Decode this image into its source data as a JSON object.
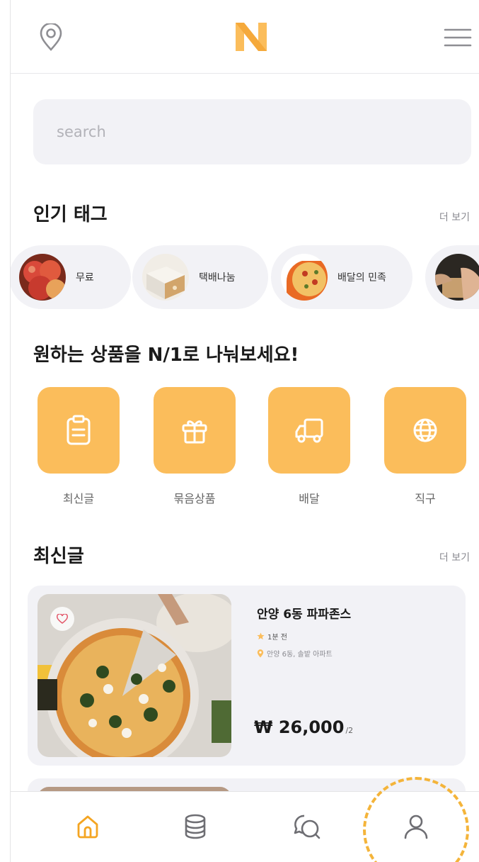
{
  "colors": {
    "accent": "#fbbd5b",
    "nav_active": "#f4a522",
    "surface": "#f2f2f6"
  },
  "header": {
    "logo_text": "N",
    "location_icon": "location-pin-icon",
    "menu_icon": "hamburger-menu-icon"
  },
  "search": {
    "placeholder": "search"
  },
  "popular_tags": {
    "title": "인기 태그",
    "more": "더 보기",
    "items": [
      {
        "label": "무료",
        "image": "apples"
      },
      {
        "label": "택배나눔",
        "image": "parcel-box"
      },
      {
        "label": "배달의 민족",
        "image": "pizza"
      },
      {
        "label": "",
        "image": "hands"
      }
    ]
  },
  "categories": {
    "title": "원하는 상품을 N/1로 나눠보세요!",
    "items": [
      {
        "label": "최신글",
        "icon": "clipboard-icon"
      },
      {
        "label": "묶음상품",
        "icon": "gift-icon"
      },
      {
        "label": "배달",
        "icon": "truck-icon"
      },
      {
        "label": "직구",
        "icon": "globe-icon"
      }
    ]
  },
  "latest": {
    "title": "최신글",
    "more": "더 보기",
    "posts": [
      {
        "title": "안양 6동 파파존스",
        "time": "1분 전",
        "location": "안양 6동, 솔밭 아파트",
        "price": "₩ 26,000",
        "per": "/2"
      }
    ]
  },
  "bottom_nav": [
    {
      "name": "home",
      "icon": "home-icon",
      "active": true
    },
    {
      "name": "database",
      "icon": "database-icon",
      "active": false
    },
    {
      "name": "chat",
      "icon": "chat-icon",
      "active": false
    },
    {
      "name": "profile",
      "icon": "profile-icon",
      "active": false
    }
  ]
}
